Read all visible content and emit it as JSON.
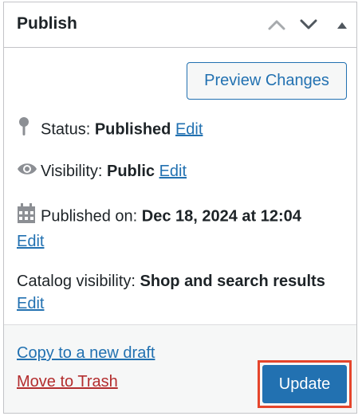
{
  "panel": {
    "title": "Publish",
    "header_icons": [
      "chevron-up-icon",
      "chevron-down-icon",
      "triangle-up-icon"
    ]
  },
  "preview_button": {
    "label": "Preview Changes"
  },
  "status": {
    "label": "Status:",
    "value": "Published",
    "edit": "Edit",
    "icon": "pin-icon"
  },
  "visibility": {
    "label": "Visibility:",
    "value": "Public",
    "edit": "Edit",
    "icon": "eye-icon"
  },
  "published_on": {
    "label": "Published on:",
    "value": "Dec 18, 2024 at 12:04",
    "edit": "Edit",
    "icon": "calendar-icon"
  },
  "catalog": {
    "label": "Catalog visibility:",
    "value": "Shop and search results",
    "edit": "Edit"
  },
  "footer": {
    "copy_draft": "Copy to a new draft",
    "move_trash": "Move to Trash",
    "update": "Update"
  },
  "colors": {
    "link": "#2271b1",
    "trash": "#b32d2e",
    "primary": "#2271b1",
    "highlight": "#e5452c"
  }
}
